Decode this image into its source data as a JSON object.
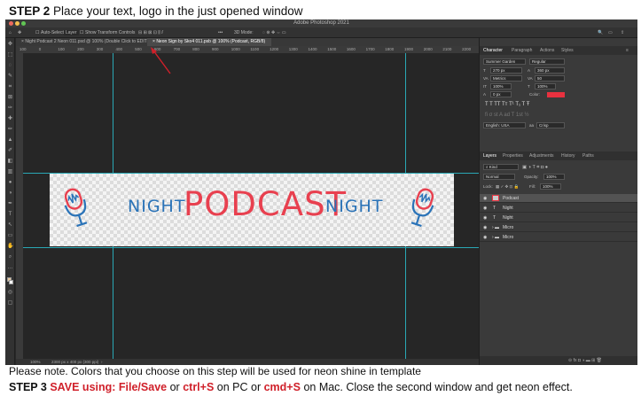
{
  "captions": {
    "step2_label": "STEP 2",
    "step2_text": "Place your text, logo in the just opened window",
    "note": "Please note. Colors that you choose on this step will be used for neon shine in template",
    "step3_label": "STEP 3",
    "step3_save": "SAVE using: File/Save",
    "step3_or1": "or",
    "step3_ctrl": "ctrl+S",
    "step3_pc": "on PC or",
    "step3_cmd": "cmd+S",
    "step3_rest": "on Mac. Close the second window and get neon effect."
  },
  "app": {
    "title": "Adobe Photoshop 2021",
    "traffic_colors": [
      "#ec6a5e",
      "#f4bf4f",
      "#61c554"
    ]
  },
  "options_bar": {
    "auto_select": "Auto-Select:",
    "layer_select": "Layer",
    "show_transform": "Show Transform Controls",
    "mode_3d": "3D Mode:"
  },
  "tabs": [
    {
      "label": "Night Podcast 2 Neon 011.psd @ 100% (Double Click to EDIT NEON, RGB/8)"
    },
    {
      "label": "Neon Sign by Sko4 011.psb @ 100% (Podcast, RGB/8)"
    }
  ],
  "ruler_ticks": [
    "100",
    "0",
    "100",
    "200",
    "300",
    "400",
    "500",
    "600",
    "700",
    "800",
    "900",
    "1000",
    "1100",
    "1200",
    "1300",
    "1400",
    "1500",
    "1600",
    "1700",
    "1800",
    "1900",
    "2000",
    "2100",
    "2200"
  ],
  "artwork": {
    "night_left": "NIGHT",
    "podcast": "PODCAST",
    "night_right": "NIGHT",
    "blue": "#2a73b8",
    "red": "#e8404f"
  },
  "status": {
    "zoom": "100%",
    "size": "2300 px x 400 px (300 ppi)"
  },
  "character_panel": {
    "tabs": [
      "Character",
      "Paragraph",
      "Actions",
      "Styles"
    ],
    "font_family": "Summer Garden",
    "font_style": "Regular",
    "font_size": "270 px",
    "leading": "360 px",
    "kerning": "Metrics",
    "tracking": "50",
    "vscale": "100%",
    "hscale": "100%",
    "baseline": "0 px",
    "color_label": "Color:",
    "color_value": "#e8313f",
    "language": "English: USA",
    "antialias": "Crisp"
  },
  "layers_panel": {
    "tabs": [
      "Layers",
      "Properties",
      "Adjustments",
      "History",
      "Paths"
    ],
    "kind": "Kind",
    "blend_mode": "Normal",
    "opacity_label": "Opacity:",
    "opacity": "100%",
    "lock_label": "Lock:",
    "fill_label": "Fill:",
    "fill": "100%",
    "layers": [
      {
        "name": "Podcast",
        "type": "image",
        "selected": true
      },
      {
        "name": "Night",
        "type": "text",
        "selected": false
      },
      {
        "name": "Night",
        "type": "text",
        "selected": false
      },
      {
        "name": "Micro",
        "type": "folder",
        "selected": false
      },
      {
        "name": "Micro",
        "type": "folder",
        "selected": false
      }
    ],
    "footer_icons": "fx"
  },
  "annotation_arrow_color": "#d0202a"
}
